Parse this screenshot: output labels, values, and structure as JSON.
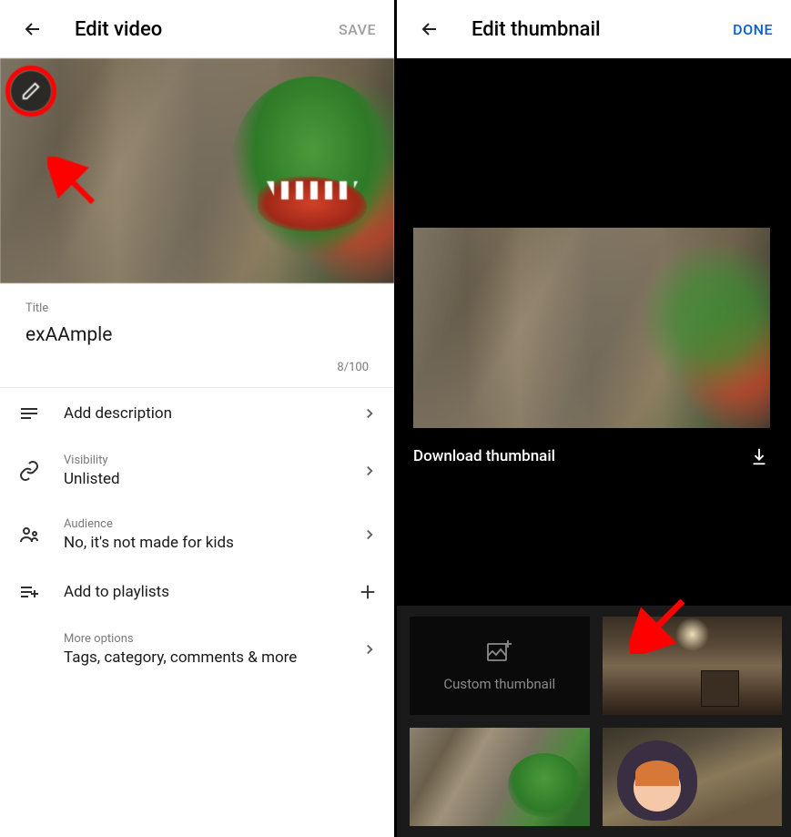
{
  "left": {
    "header": {
      "title": "Edit video",
      "action": "SAVE"
    },
    "title_field": {
      "label": "Title",
      "value": "exAAmple",
      "counter": "8/100"
    },
    "rows": {
      "description": {
        "label": "Add description"
      },
      "visibility": {
        "label": "Visibility",
        "value": "Unlisted"
      },
      "audience": {
        "label": "Audience",
        "value": "No, it's not made for kids"
      },
      "playlists": {
        "label": "Add to playlists"
      },
      "more": {
        "label": "More options",
        "value": "Tags, category, comments & more"
      }
    }
  },
  "right": {
    "header": {
      "title": "Edit thumbnail",
      "action": "DONE"
    },
    "download_label": "Download thumbnail",
    "custom_thumb_label": "Custom thumbnail"
  }
}
